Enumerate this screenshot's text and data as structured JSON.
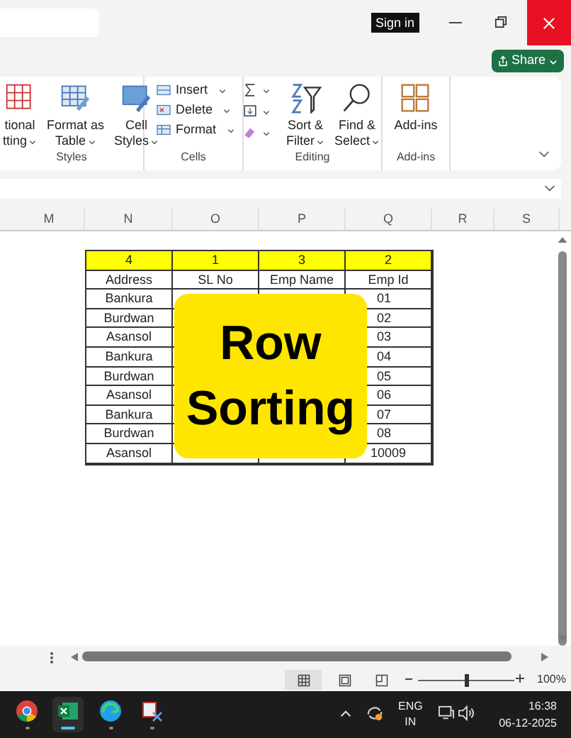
{
  "title_bar": {
    "sign_in": "Sign in"
  },
  "share": {
    "label": "Share"
  },
  "ribbon": {
    "groups": [
      {
        "kind": "large",
        "label": "Styles",
        "buttons": [
          {
            "lines": [
              "tional",
              "tting"
            ],
            "caret": true
          },
          {
            "lines": [
              "Format as",
              "Table"
            ],
            "caret": true
          },
          {
            "lines": [
              "Cell",
              "Styles"
            ],
            "caret": true
          }
        ]
      },
      {
        "kind": "rows",
        "label": "Cells",
        "buttons": [
          {
            "label": "Insert"
          },
          {
            "label": "Delete"
          },
          {
            "label": "Format"
          }
        ]
      },
      {
        "kind": "editing",
        "label": "Editing",
        "buttons": [
          {
            "lines": [
              "Sort &",
              "Filter"
            ],
            "caret": true
          },
          {
            "lines": [
              "Find &",
              "Select"
            ],
            "caret": true
          }
        ]
      },
      {
        "kind": "large",
        "label": "Add-ins",
        "buttons": [
          {
            "lines": [
              "Add-ins"
            ],
            "caret": false
          }
        ]
      }
    ]
  },
  "sheet": {
    "columns": [
      "M",
      "N",
      "O",
      "P",
      "Q",
      "R",
      "S"
    ],
    "order_row": [
      "4",
      "1",
      "3",
      "2"
    ],
    "header_row": [
      "Address",
      "SL No",
      "Emp Name",
      "Emp Id"
    ],
    "rows": [
      {
        "address": "Bankura",
        "emp_id": "01",
        "clipped": true
      },
      {
        "address": "Burdwan",
        "emp_id": "02",
        "clipped": true
      },
      {
        "address": "Asansol",
        "emp_id": "03",
        "clipped": true
      },
      {
        "address": "Bankura",
        "emp_id": "04",
        "clipped": true
      },
      {
        "address": "Burdwan",
        "emp_id": "05",
        "clipped": true
      },
      {
        "address": "Asansol",
        "emp_id": "06",
        "clipped": true
      },
      {
        "address": "Bankura",
        "emp_id": "07",
        "clipped": true
      },
      {
        "address": "Burdwan",
        "emp_id": "08",
        "clipped": true
      },
      {
        "address": "Asansol",
        "emp_id": "10009",
        "clipped": false
      }
    ]
  },
  "overlay": {
    "lines": [
      "Row",
      "Sorting"
    ]
  },
  "status_bar": {
    "zoom": {
      "level": 0.5,
      "reading": "100%"
    }
  },
  "taskbar": {
    "language": [
      "ENG",
      "IN"
    ],
    "time": "16:38",
    "date": "06-12-2025"
  }
}
